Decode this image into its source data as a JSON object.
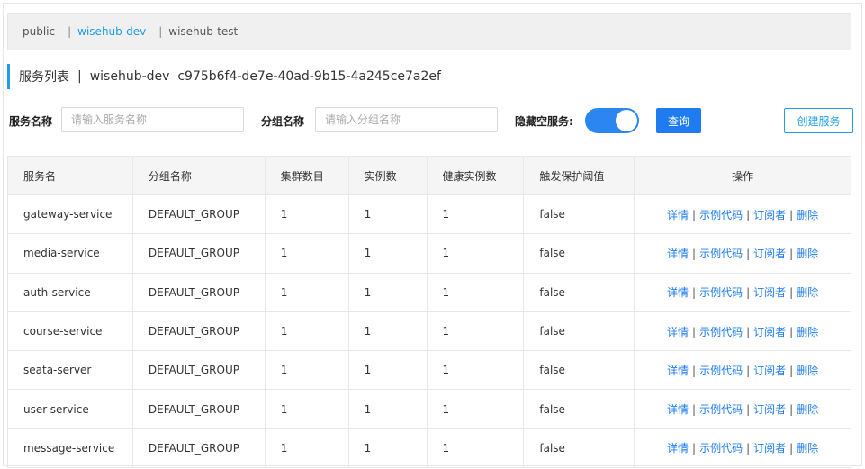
{
  "namespaces": [
    {
      "label": "public",
      "active": false
    },
    {
      "label": "wisehub-dev",
      "active": true
    },
    {
      "label": "wisehub-test",
      "active": false
    }
  ],
  "ns_separator": "|",
  "header": {
    "title": "服务列表",
    "separator": "|",
    "namespace_info": "wisehub-dev  c975b6f4-de7e-40ad-9b15-4a245ce7a2ef"
  },
  "filters": {
    "service_name_label": "服务名称",
    "service_name_placeholder": "请输入服务名称",
    "service_name_value": "",
    "group_name_label": "分组名称",
    "group_name_placeholder": "请输入分组名称",
    "group_name_value": "",
    "hide_empty_label": "隐藏空服务:",
    "hide_empty_on": true,
    "query_button": "查询",
    "create_button": "创建服务"
  },
  "table": {
    "columns": [
      "服务名",
      "分组名称",
      "集群数目",
      "实例数",
      "健康实例数",
      "触发保护阈值",
      "操作"
    ],
    "actions": [
      "详情",
      "示例代码",
      "订阅者",
      "删除"
    ],
    "action_separator": "|",
    "rows": [
      {
        "name": "gateway-service",
        "group": "DEFAULT_GROUP",
        "clusters": "1",
        "instances": "1",
        "healthy": "1",
        "threshold": "false"
      },
      {
        "name": "media-service",
        "group": "DEFAULT_GROUP",
        "clusters": "1",
        "instances": "1",
        "healthy": "1",
        "threshold": "false"
      },
      {
        "name": "auth-service",
        "group": "DEFAULT_GROUP",
        "clusters": "1",
        "instances": "1",
        "healthy": "1",
        "threshold": "false"
      },
      {
        "name": "course-service",
        "group": "DEFAULT_GROUP",
        "clusters": "1",
        "instances": "1",
        "healthy": "1",
        "threshold": "false"
      },
      {
        "name": "seata-server",
        "group": "DEFAULT_GROUP",
        "clusters": "1",
        "instances": "1",
        "healthy": "1",
        "threshold": "false"
      },
      {
        "name": "user-service",
        "group": "DEFAULT_GROUP",
        "clusters": "1",
        "instances": "1",
        "healthy": "1",
        "threshold": "false"
      },
      {
        "name": "message-service",
        "group": "DEFAULT_GROUP",
        "clusters": "1",
        "instances": "1",
        "healthy": "1",
        "threshold": "false"
      }
    ]
  },
  "colors": {
    "accent": "#1e9ee8",
    "toggle_on": "#2b86f2",
    "primary_button": "#1e7cf0",
    "link": "#1e7cf0"
  }
}
